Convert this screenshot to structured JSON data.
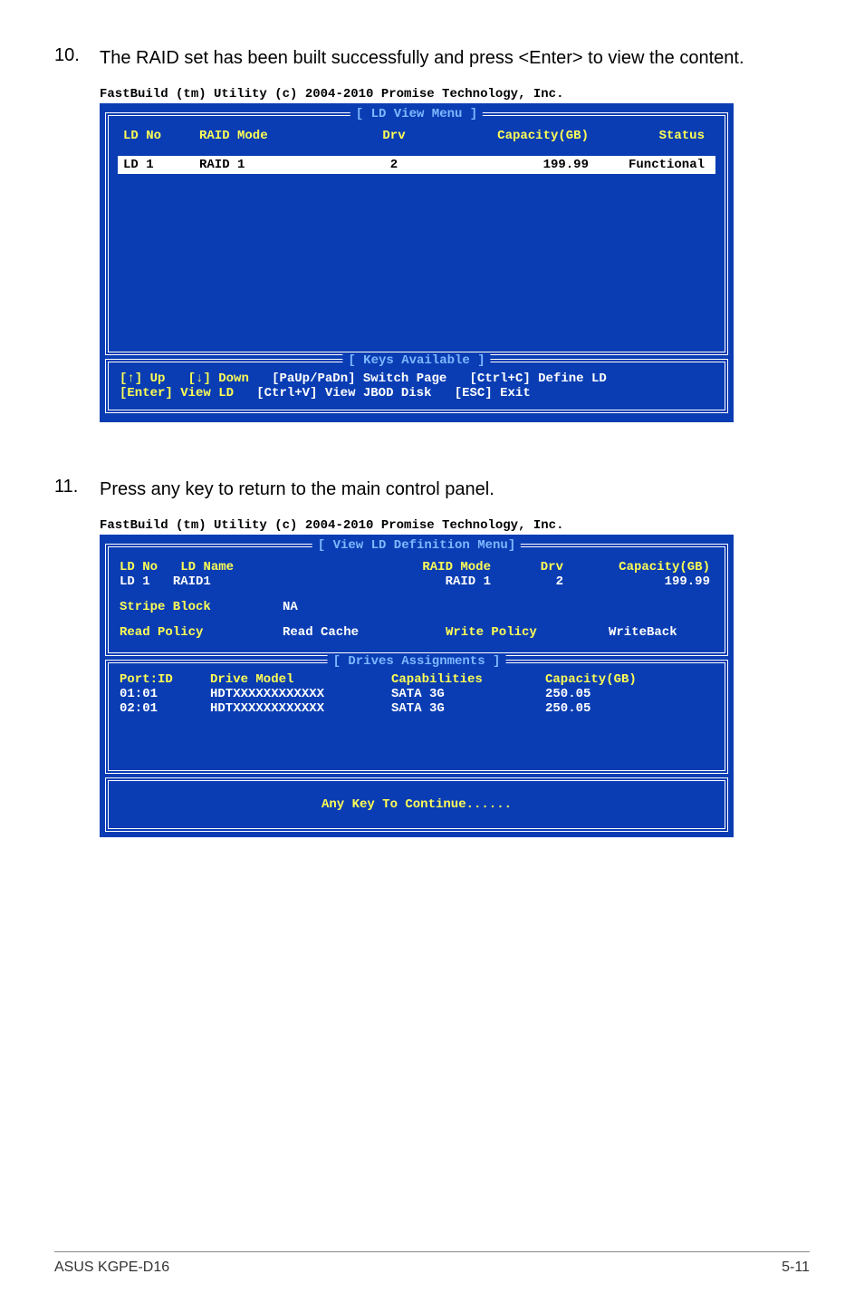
{
  "step10": {
    "num": "10.",
    "text": "The RAID set has been built successfully and press <Enter> to view the content."
  },
  "step11": {
    "num": "11.",
    "text": "Press any key to return to the main control panel."
  },
  "terminal_caption": "FastBuild (tm) Utility (c) 2004-2010 Promise Technology, Inc.",
  "ld_view": {
    "title": "[ LD View Menu ]",
    "headers": {
      "ldno": "LD No",
      "mode": "RAID Mode",
      "drv": "Drv",
      "cap": "Capacity(GB)",
      "status": "Status"
    },
    "row": {
      "ldno": "LD  1",
      "mode": "RAID 1",
      "drv": "2",
      "cap": "199.99",
      "status": "Functional"
    }
  },
  "keys": {
    "title": "[ Keys Available ]",
    "line1": {
      "k1": "[↑] Up",
      "k2": "[↓] Down",
      "a1": "[PaUp/PaDn] Switch Page",
      "a2": "[Ctrl+C] Define LD"
    },
    "line2": {
      "k1": "[Enter] View LD",
      "a1": "[Ctrl+V] View JBOD Disk",
      "a2": "[ESC] Exit"
    }
  },
  "def": {
    "title": "[ View LD Definition Menu]",
    "h1": {
      "ldno": "LD No",
      "ldname": "LD Name",
      "mode": "RAID Mode",
      "drv": "Drv",
      "cap": "Capacity(GB)"
    },
    "r1": {
      "ldno": "LD  1",
      "ldname": "RAID1",
      "mode": "RAID 1",
      "drv": "2",
      "cap": "199.99"
    },
    "h2": {
      "sb": "Stripe Block",
      "na": "NA"
    },
    "r2": {
      "rp": "Read Policy",
      "rc": "Read Cache",
      "wp": "Write Policy",
      "wb": "WriteBack"
    }
  },
  "drives": {
    "title": "[ Drives Assignments ]",
    "h": {
      "port": "Port:ID",
      "model": "Drive Model",
      "caps": "Capabilities",
      "cap": "Capacity(GB)"
    },
    "rows": [
      {
        "port": "01:01",
        "model": "HDTXXXXXXXXXXXX",
        "caps": "SATA 3G",
        "cap": "250.05"
      },
      {
        "port": "02:01",
        "model": "HDTXXXXXXXXXXXX",
        "caps": "SATA 3G",
        "cap": "250.05"
      }
    ]
  },
  "continue_text": "Any Key To Continue......",
  "footer": {
    "left": "ASUS KGPE-D16",
    "right": "5-11"
  }
}
